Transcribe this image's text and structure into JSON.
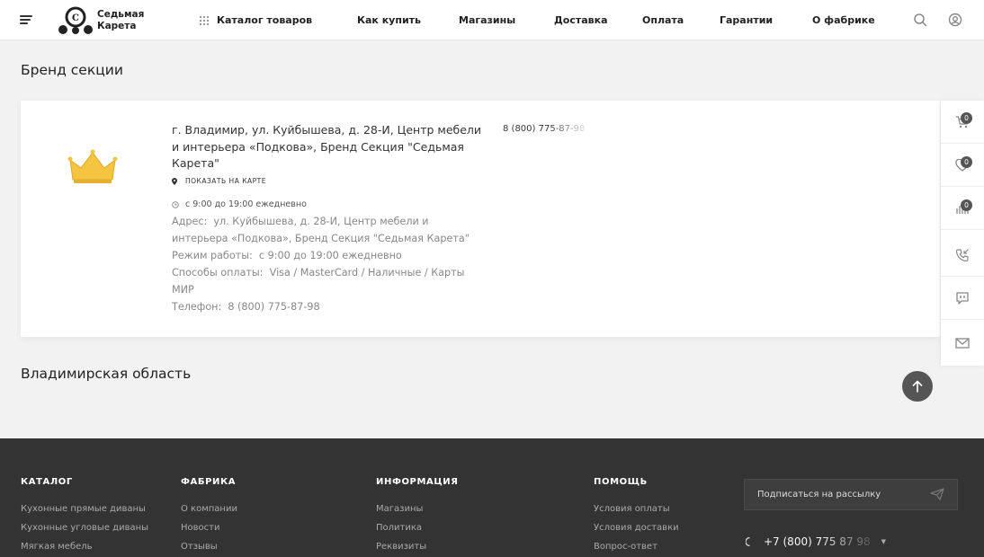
{
  "header": {
    "logo_line1": "Седьмая",
    "logo_line2": "Карета",
    "nav": [
      "Каталог товаров",
      "Как купить",
      "Магазины",
      "Доставка",
      "Оплата",
      "Гарантии",
      "О фабрике"
    ]
  },
  "main": {
    "section_title": "Бренд секции",
    "store": {
      "name": "г. Владимир, ул. Куйбышева, д. 28-И, Центр мебели и интерьера «Подкова», Бренд Секция \"Седьмая Карета\"",
      "map_link": "ПОКАЗАТЬ НА КАРТЕ",
      "hours_short": "с 9:00 до 19:00 ежедневно",
      "address_label": "Адрес:",
      "address_value": "ул. Куйбышева, д. 28-И, Центр мебели и интерьера «Подкова», Бренд Секция \"Седьмая Карета\"",
      "schedule_label": "Режим работы:",
      "schedule_value": "с 9:00 до 19:00 ежедневно",
      "payment_label": "Способы оплаты:",
      "payment_value": "Visa / MasterCard / Наличные / Карты МИР",
      "phone_label": "Телефон:",
      "phone_value": "8 (800) 775-87-98",
      "phone_header": "8 (800) 775-87-98"
    },
    "region_title": "Владимирская область"
  },
  "side_panel": {
    "cart_count": "0",
    "favorites_count": "0",
    "compare_count": "0"
  },
  "footer": {
    "columns": [
      {
        "title": "КАТАЛОГ",
        "links": [
          "Кухонные прямые диваны",
          "Кухонные угловые диваны",
          "Мягкая мебель"
        ]
      },
      {
        "title": "ФАБРИКА",
        "links": [
          "О компании",
          "Новости",
          "Отзывы"
        ]
      },
      {
        "title": "ИНФОРМАЦИЯ",
        "links": [
          "Магазины",
          "Политика",
          "Реквизиты"
        ]
      },
      {
        "title": "ПОМОЩЬ",
        "links": [
          "Условия оплаты",
          "Условия доставки",
          "Вопрос-ответ"
        ]
      }
    ],
    "subscribe_label": "Подписаться на рассылку",
    "phone": "+7 (800) 775 87 98"
  },
  "colors": {
    "accent": "#555555",
    "footer_bg": "#333333",
    "page_bg": "#f2f2f2",
    "crown": "#f5c542"
  }
}
